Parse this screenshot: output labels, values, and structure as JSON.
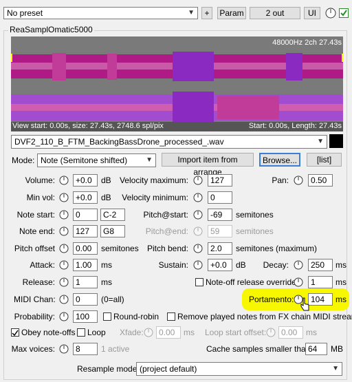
{
  "top": {
    "preset": "No preset",
    "plus": "+",
    "param": "Param",
    "out": "2 out",
    "ui": "UI"
  },
  "plugin_name": "ReaSamplOmatic5000",
  "waveform": {
    "info": "48000Hz 2ch 27.43s",
    "view_info": "View start: 0.00s, size: 27.43s, 2748.6 spl/pix",
    "range_info": "Start: 0.00s, Length: 27.43s"
  },
  "file": {
    "name": "DVF2_110_B_FTM_BackingBassDrone_processed_.wav"
  },
  "mode": {
    "label": "Mode:",
    "value": "Note (Semitone shifted)",
    "import": "Import item from arrange",
    "browse": "Browse...",
    "list": "[list]"
  },
  "rows": {
    "volume": {
      "label": "Volume:",
      "value": "+0.0",
      "unit": "dB"
    },
    "velmax": {
      "label": "Velocity maximum:",
      "value": "127"
    },
    "pan": {
      "label": "Pan:",
      "value": "0.50"
    },
    "minvol": {
      "label": "Min vol:",
      "value": "+0.0",
      "unit": "dB"
    },
    "velmin": {
      "label": "Velocity minimum:",
      "value": "0"
    },
    "notestart": {
      "label": "Note start:",
      "value": "0",
      "name": "C-2"
    },
    "pitchstart": {
      "label": "Pitch@start:",
      "value": "-69",
      "unit": "semitones"
    },
    "noteend": {
      "label": "Note end:",
      "value": "127",
      "name": "G8"
    },
    "pitchend": {
      "label": "Pitch@end:",
      "value": "59",
      "unit": "semitones"
    },
    "pitchoffset": {
      "label": "Pitch offset",
      "value": "0.00",
      "unit": "semitones"
    },
    "pitchbend": {
      "label": "Pitch bend:",
      "value": "2.0",
      "unit": "semitones (maximum)"
    },
    "attack": {
      "label": "Attack:",
      "value": "1.00",
      "unit": "ms"
    },
    "sustain": {
      "label": "Sustain:",
      "value": "+0.0",
      "unit": "dB"
    },
    "decay": {
      "label": "Decay:",
      "value": "250",
      "unit": "ms"
    },
    "release": {
      "label": "Release:",
      "value": "1",
      "unit": "ms"
    },
    "noteoff": {
      "label": "Note-off release override:",
      "value": "1",
      "unit": "ms"
    },
    "midichan": {
      "label": "MIDI Chan:",
      "value": "0",
      "note": "(0=all)"
    },
    "portamento": {
      "label": "Portamento:",
      "value": "104",
      "unit": "ms"
    },
    "probability": {
      "label": "Probability:",
      "value": "100"
    },
    "roundrobin": {
      "label": "Round-robin"
    },
    "removenotes": {
      "label": "Remove played notes from FX chain MIDI stream"
    },
    "obey": {
      "label": "Obey note-offs"
    },
    "loop": {
      "label": "Loop"
    },
    "xfade": {
      "label": "Xfade:",
      "value": "0.00",
      "unit": "ms"
    },
    "loopstart": {
      "label": "Loop start offset:",
      "value": "0.00",
      "unit": "ms"
    },
    "maxvoices": {
      "label": "Max voices:",
      "value": "8",
      "note": "1 active"
    },
    "cache": {
      "label": "Cache samples smaller than:",
      "value": "64",
      "unit": "MB"
    },
    "resample": {
      "label": "Resample mode:",
      "value": "(project default)"
    }
  },
  "colors": {
    "highlight": "#f7f700",
    "wave_bg": "#7a7a7a",
    "wave_top": "#b01a86",
    "wave_bottom": "#a24dd0"
  }
}
